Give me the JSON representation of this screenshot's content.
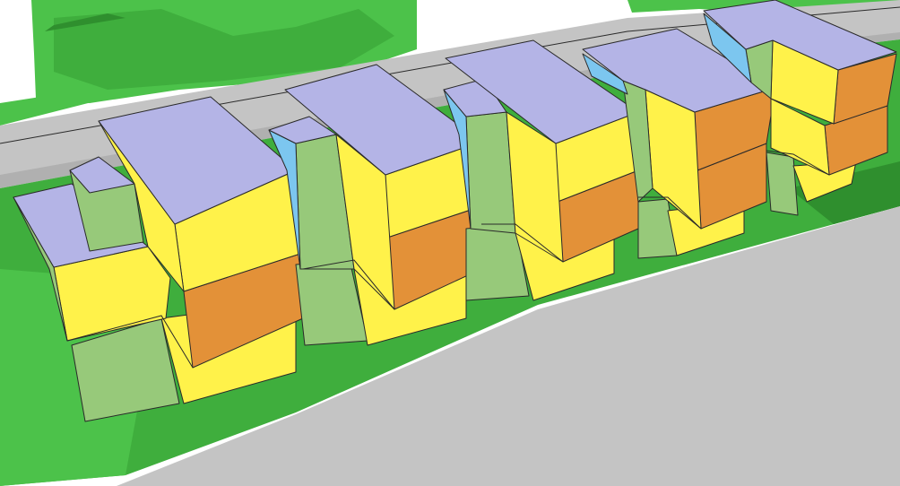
{
  "scene": {
    "description_type": "3d-massing-model",
    "blocks_count": 5
  },
  "colors": {
    "background": "#ffffff",
    "terrain_light": "#4cc24a",
    "terrain_mid": "#3fae3d",
    "terrain_dark": "#2f8f2e",
    "road": "#c4c4c4",
    "road_edge": "#b0b0b0",
    "roof": "#b4b4e6",
    "roof_side": "#9fa0d6",
    "wall_yellow": "#fff24a",
    "wall_yellow_dark": "#f2e23c",
    "wall_orange": "#e39138",
    "wall_green": "#97c97a",
    "wall_blue": "#7cc6ef",
    "outline": "#2a2a2a"
  }
}
